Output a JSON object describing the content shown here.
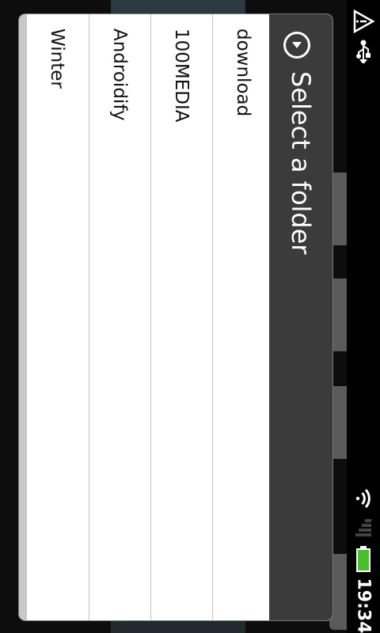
{
  "status_bar": {
    "time": "19:34",
    "icons": [
      "alert-icon",
      "usb-icon",
      "wifi-icon",
      "signal-icon",
      "battery-icon"
    ],
    "battery_color": "#48c02a"
  },
  "dialog": {
    "title": "Select a folder",
    "title_icon": "circle-chevron-icon",
    "folders": [
      {
        "label": "download"
      },
      {
        "label": "100MEDIA"
      },
      {
        "label": "Androidify"
      },
      {
        "label": "Winter"
      }
    ]
  }
}
